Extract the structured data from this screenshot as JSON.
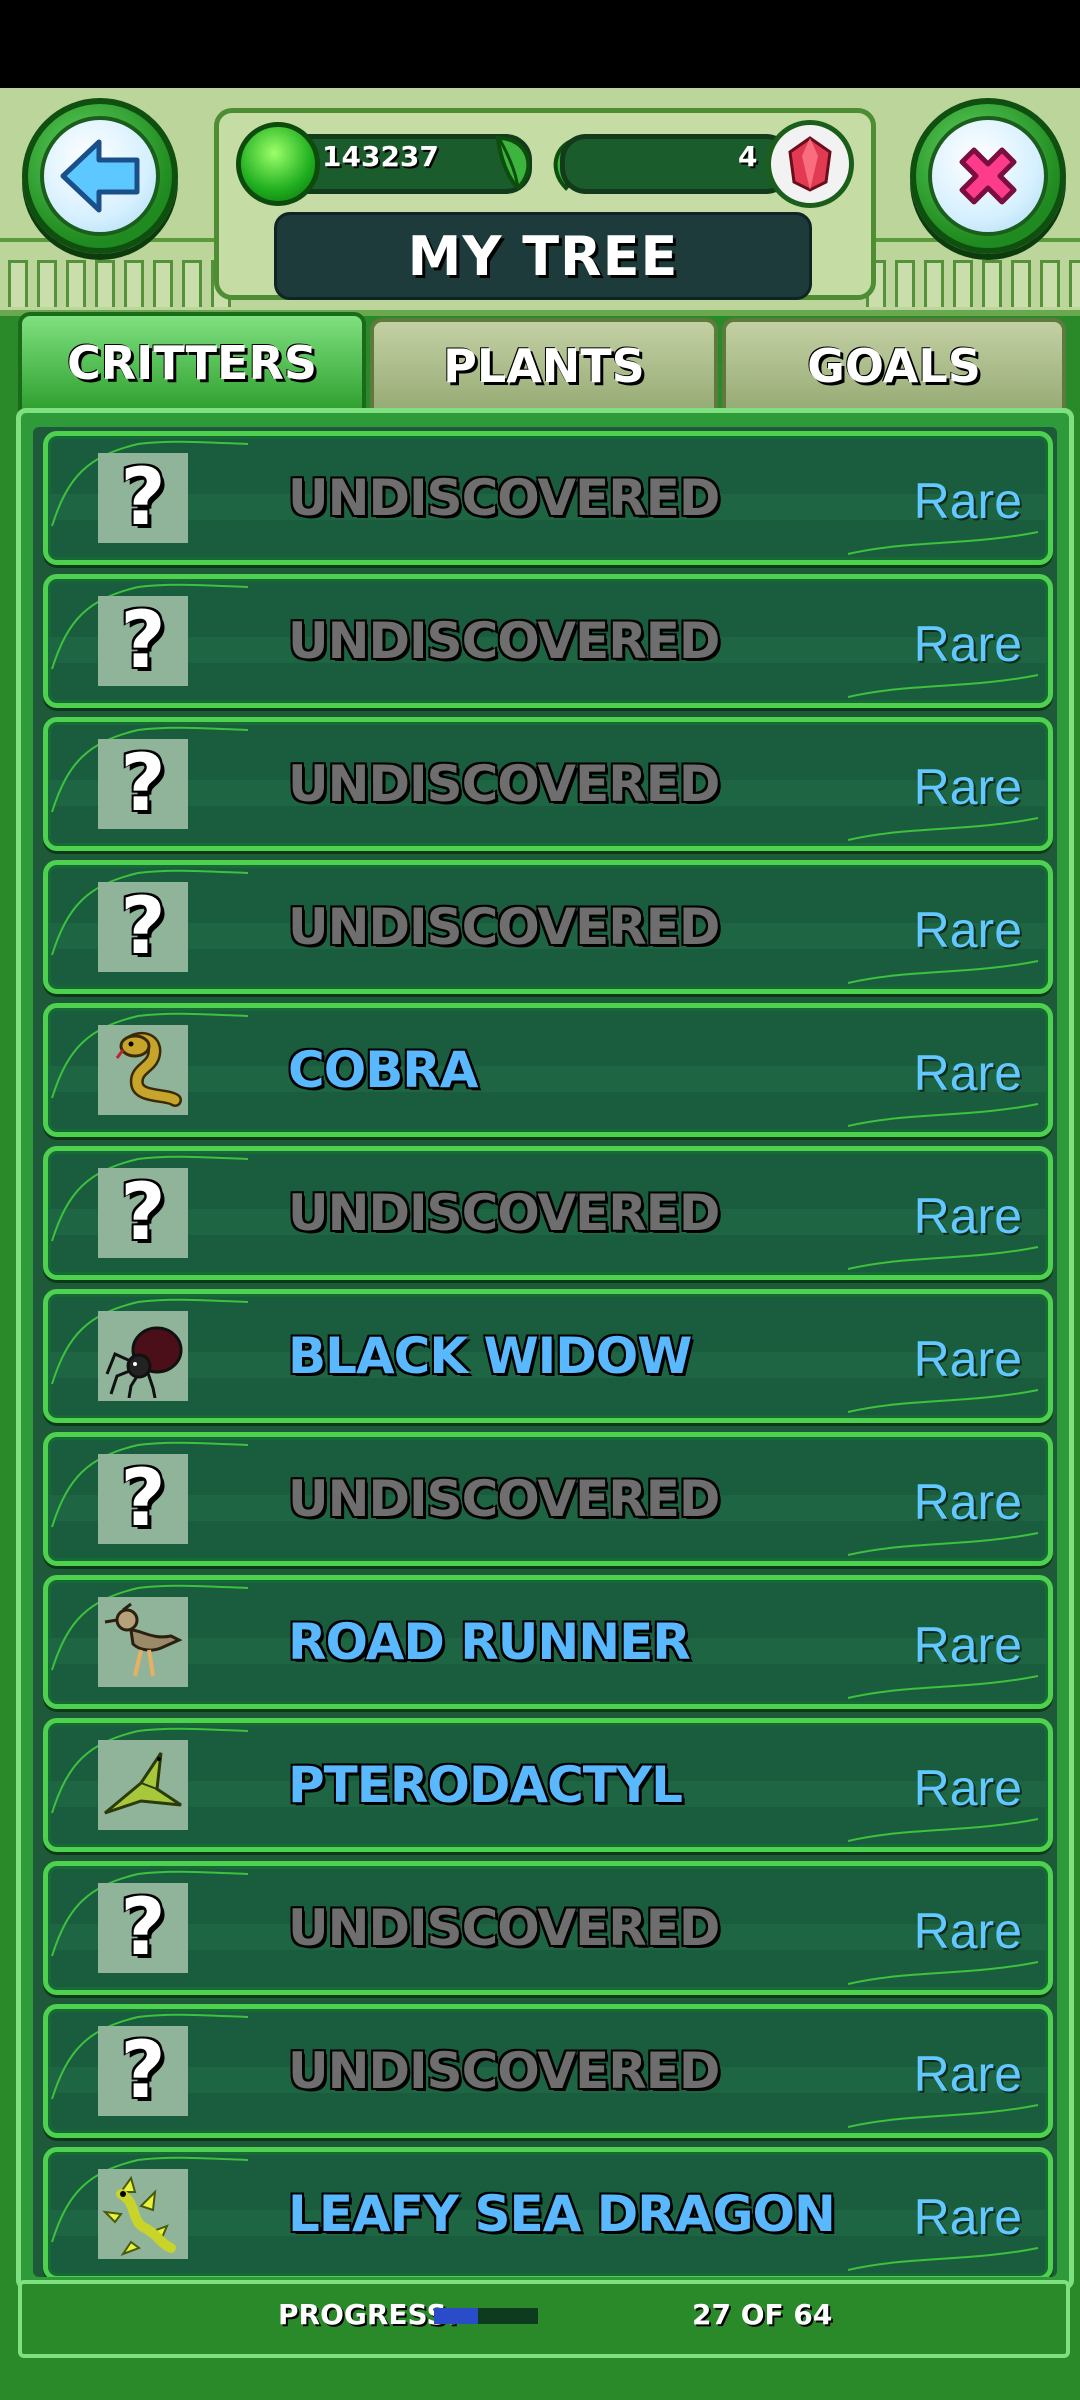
{
  "header": {
    "back_icon": "back-arrow-icon",
    "close_icon": "close-x-icon",
    "gum_count": "143237",
    "gem_count": "4",
    "title": "MY TREE"
  },
  "tabs": [
    {
      "label": "CRITTERS",
      "active": true
    },
    {
      "label": "PLANTS",
      "active": false
    },
    {
      "label": "GOALS",
      "active": false
    }
  ],
  "critters": [
    {
      "name": "UNDISCOVERED",
      "rarity": "Rare",
      "discovered": false,
      "icon": "question-mark-icon"
    },
    {
      "name": "UNDISCOVERED",
      "rarity": "Rare",
      "discovered": false,
      "icon": "question-mark-icon"
    },
    {
      "name": "UNDISCOVERED",
      "rarity": "Rare",
      "discovered": false,
      "icon": "question-mark-icon"
    },
    {
      "name": "UNDISCOVERED",
      "rarity": "Rare",
      "discovered": false,
      "icon": "question-mark-icon"
    },
    {
      "name": "COBRA",
      "rarity": "Rare",
      "discovered": true,
      "icon": "cobra-icon"
    },
    {
      "name": "UNDISCOVERED",
      "rarity": "Rare",
      "discovered": false,
      "icon": "question-mark-icon"
    },
    {
      "name": "BLACK WIDOW",
      "rarity": "Rare",
      "discovered": true,
      "icon": "spider-icon"
    },
    {
      "name": "UNDISCOVERED",
      "rarity": "Rare",
      "discovered": false,
      "icon": "question-mark-icon"
    },
    {
      "name": "ROAD RUNNER",
      "rarity": "Rare",
      "discovered": true,
      "icon": "roadrunner-icon"
    },
    {
      "name": "PTERODACTYL",
      "rarity": "Rare",
      "discovered": true,
      "icon": "pterodactyl-icon"
    },
    {
      "name": "UNDISCOVERED",
      "rarity": "Rare",
      "discovered": false,
      "icon": "question-mark-icon"
    },
    {
      "name": "UNDISCOVERED",
      "rarity": "Rare",
      "discovered": false,
      "icon": "question-mark-icon"
    },
    {
      "name": "LEAFY SEA DRAGON",
      "rarity": "Rare",
      "discovered": true,
      "icon": "sea-dragon-icon"
    }
  ],
  "footer": {
    "progress_label": "PROGRESS:",
    "progress_count": "27 OF 64",
    "progress_fraction": 0.42
  },
  "colors": {
    "discovered_name": "#5ab8ff",
    "undiscovered_name": "#6e6e6e",
    "rarity_text": "#62c8ff",
    "row_border": "#4ed14e",
    "progress_fill": "#2a4cc8"
  }
}
